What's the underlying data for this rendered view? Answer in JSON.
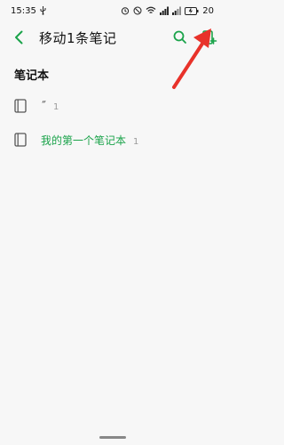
{
  "status_bar": {
    "time": "15:35",
    "battery": "20"
  },
  "header": {
    "title": "移动1条笔记",
    "back_icon": "back-chevron-icon",
    "search_icon": "search-icon",
    "new_notebook_icon": "new-notebook-icon"
  },
  "section": {
    "title": "笔记本"
  },
  "notebooks": [
    {
      "name": "˝",
      "count": "1"
    },
    {
      "name": "我的第一个笔记本",
      "count": "1"
    }
  ],
  "colors": {
    "accent": "#1aa34a",
    "annotation_arrow": "#e8322a"
  }
}
